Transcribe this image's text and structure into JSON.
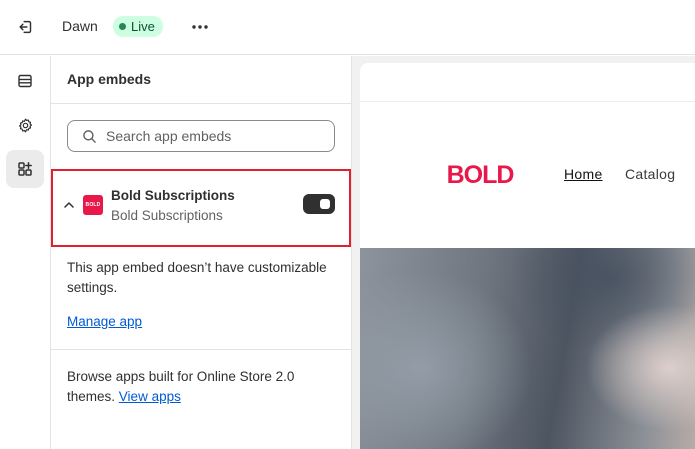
{
  "topbar": {
    "theme_name": "Dawn",
    "status_badge": "Live",
    "icons": {
      "exit": "exit-icon",
      "more": "more-horizontal-icon"
    }
  },
  "rail": {
    "items": [
      {
        "name": "sections",
        "icon": "sections-icon",
        "active": false
      },
      {
        "name": "theme-settings",
        "icon": "gear-icon",
        "active": false
      },
      {
        "name": "app-embeds",
        "icon": "app-embeds-icon",
        "active": true
      }
    ]
  },
  "panel": {
    "title": "App embeds",
    "search_placeholder": "Search app embeds",
    "embed": {
      "title": "Bold Subscriptions",
      "subtitle": "Bold Subscriptions",
      "logo_text": "BOLD",
      "enabled": true
    },
    "info_text": "This app embed doesn’t have customizable settings.",
    "manage_link": "Manage app",
    "browse_text": "Browse apps built for Online Store 2.0 themes.",
    "view_apps_link": "View apps"
  },
  "preview": {
    "logo_text": "BOLD",
    "nav": {
      "home": "Home",
      "catalog": "Catalog"
    }
  },
  "colors": {
    "accent_live_bg": "#cdfee1",
    "accent_live_text": "#0c5132",
    "link": "#005bd3",
    "brand_red": "#e8194a",
    "highlight_box": "#e0202c"
  }
}
